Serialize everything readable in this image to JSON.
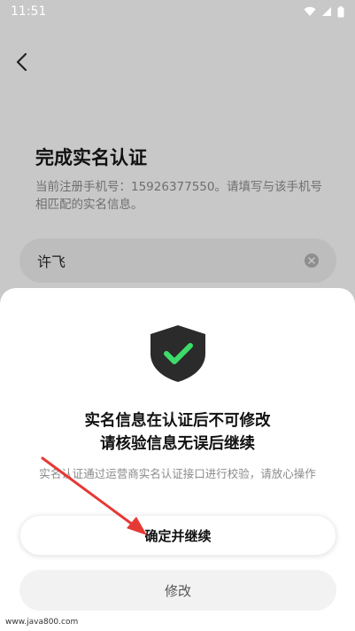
{
  "status_bar": {
    "time": "11:51",
    "icons": [
      "wifi-icon",
      "signal-icon",
      "battery-icon"
    ]
  },
  "page": {
    "title": "完成实名认证",
    "description": "当前注册手机号：15926377550。请填写与该手机号相匹配的实名信息。",
    "name_field_value": "许飞"
  },
  "sheet": {
    "title_line1": "实名信息在认证后不可修改",
    "title_line2": "请核验信息无误后继续",
    "note": "实名认证通过运营商实名认证接口进行校验，请放心操作",
    "confirm_label": "确定并继续",
    "modify_label": "修改"
  },
  "watermark": "www.java800.com",
  "colors": {
    "dim_background": "#c8c8c8",
    "shield": "#2b2b2b",
    "check": "#3ddc6a",
    "arrow": "#e53935"
  }
}
